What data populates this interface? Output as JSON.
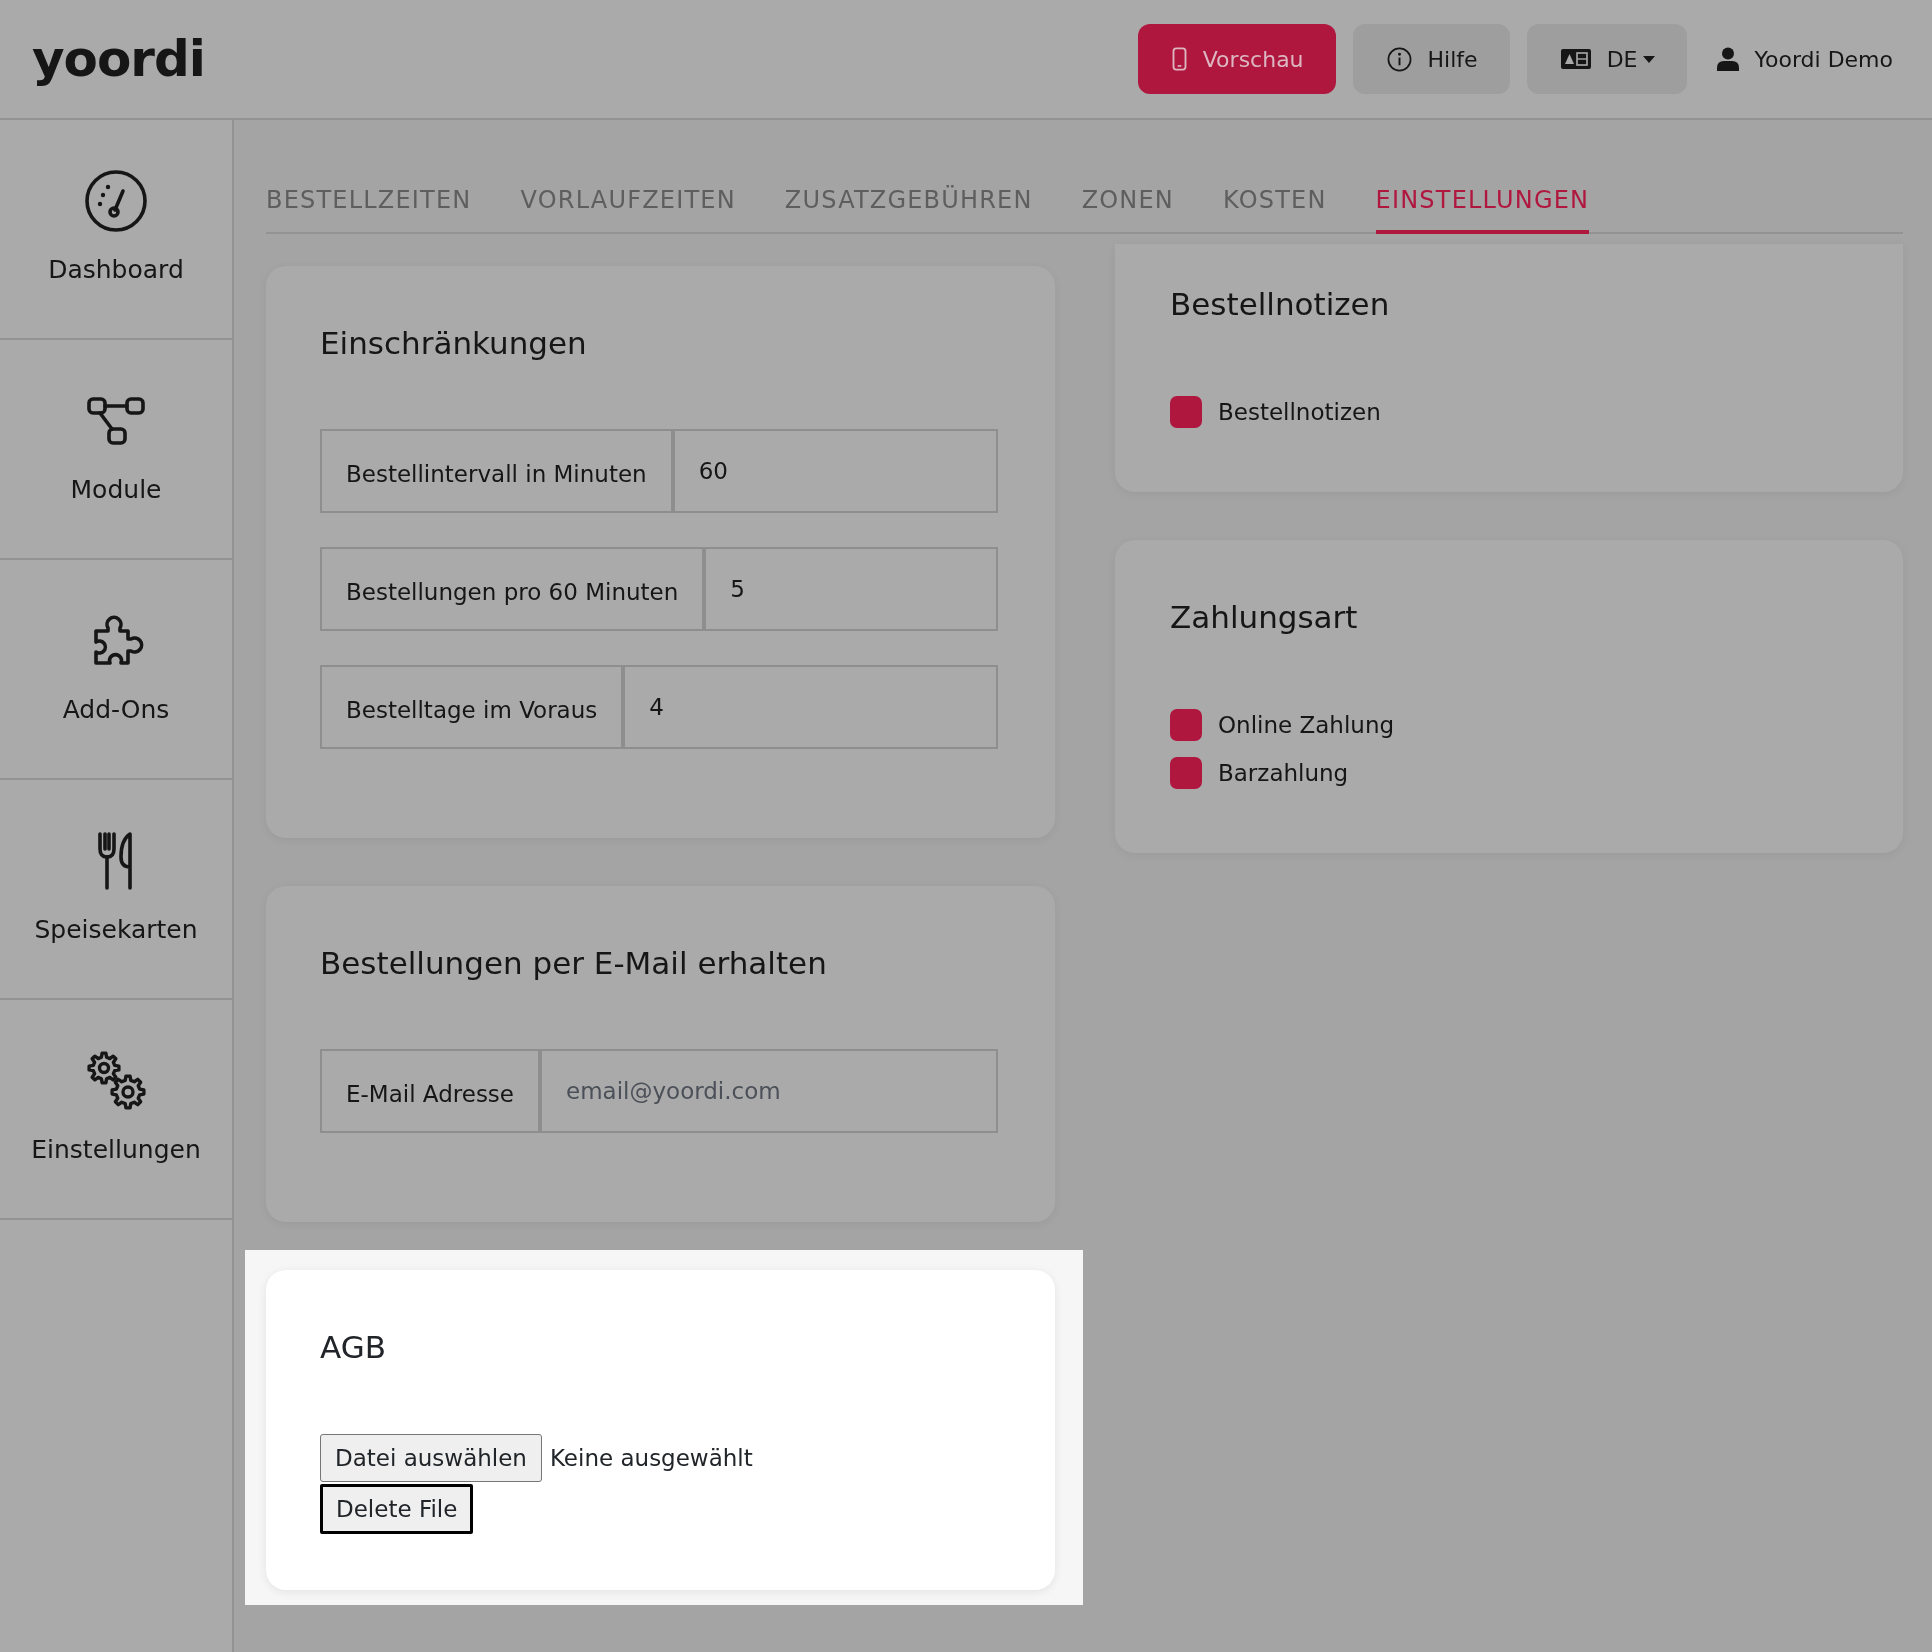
{
  "header": {
    "logo": "yoordi",
    "buttons": [
      {
        "kind": "preview",
        "label": "Vorschau"
      },
      {
        "kind": "help",
        "label": "Hilfe"
      },
      {
        "kind": "language",
        "label": "DE"
      }
    ],
    "user": {
      "name": "Yoordi Demo"
    }
  },
  "sidebar": {
    "items": [
      {
        "kind": "gauge",
        "label": "Dashboard",
        "selected": false
      },
      {
        "kind": "nodes",
        "label": "Module",
        "selected": false
      },
      {
        "kind": "puzzle",
        "label": "Add-Ons",
        "selected": false
      },
      {
        "kind": "cutlery",
        "label": "Speisekarten",
        "selected": false
      },
      {
        "kind": "gears",
        "label": "Einstellungen",
        "selected": false
      }
    ]
  },
  "tabs": [
    {
      "label": "BESTELLZEITEN",
      "selected": false
    },
    {
      "label": "VORLAUFZEITEN",
      "selected": false
    },
    {
      "label": "ZUSATZGEBÜHREN",
      "selected": false
    },
    {
      "label": "ZONEN",
      "selected": false
    },
    {
      "label": "KOSTEN",
      "selected": false
    },
    {
      "label": "EINSTELLUNGEN",
      "selected": true
    }
  ],
  "left_column": [
    {
      "kind": "fields",
      "title": "Einschränkungen",
      "highlighted": false,
      "fields": [
        {
          "label": "Bestellintervall in Minuten",
          "value": "60"
        },
        {
          "label": "Bestellungen pro 60 Minuten",
          "value": "5"
        },
        {
          "label": "Bestelltage im Voraus",
          "value": "4"
        }
      ]
    },
    {
      "kind": "fields",
      "title": "Bestellungen per E-Mail erhalten",
      "highlighted": false,
      "fields": [
        {
          "label": "E-Mail Adresse",
          "placeholder": "email@yoordi.com"
        }
      ]
    },
    {
      "kind": "upload",
      "title": "AGB",
      "highlighted": true,
      "choose_button": "Datei auswählen",
      "file_status": "Keine ausgewählt",
      "delete_button": {
        "label": "Delete File",
        "focused": true
      }
    }
  ],
  "right_column": [
    {
      "kind": "checkboxes",
      "title": "Bestellnotizen",
      "highlighted": false,
      "options": [
        {
          "label": "Bestellnotizen",
          "checked": true
        }
      ]
    },
    {
      "kind": "checkboxes",
      "title": "Zahlungsart",
      "highlighted": false,
      "options": [
        {
          "label": "Online Zahlung",
          "checked": true
        },
        {
          "label": "Barzahlung",
          "checked": true
        }
      ]
    }
  ]
}
